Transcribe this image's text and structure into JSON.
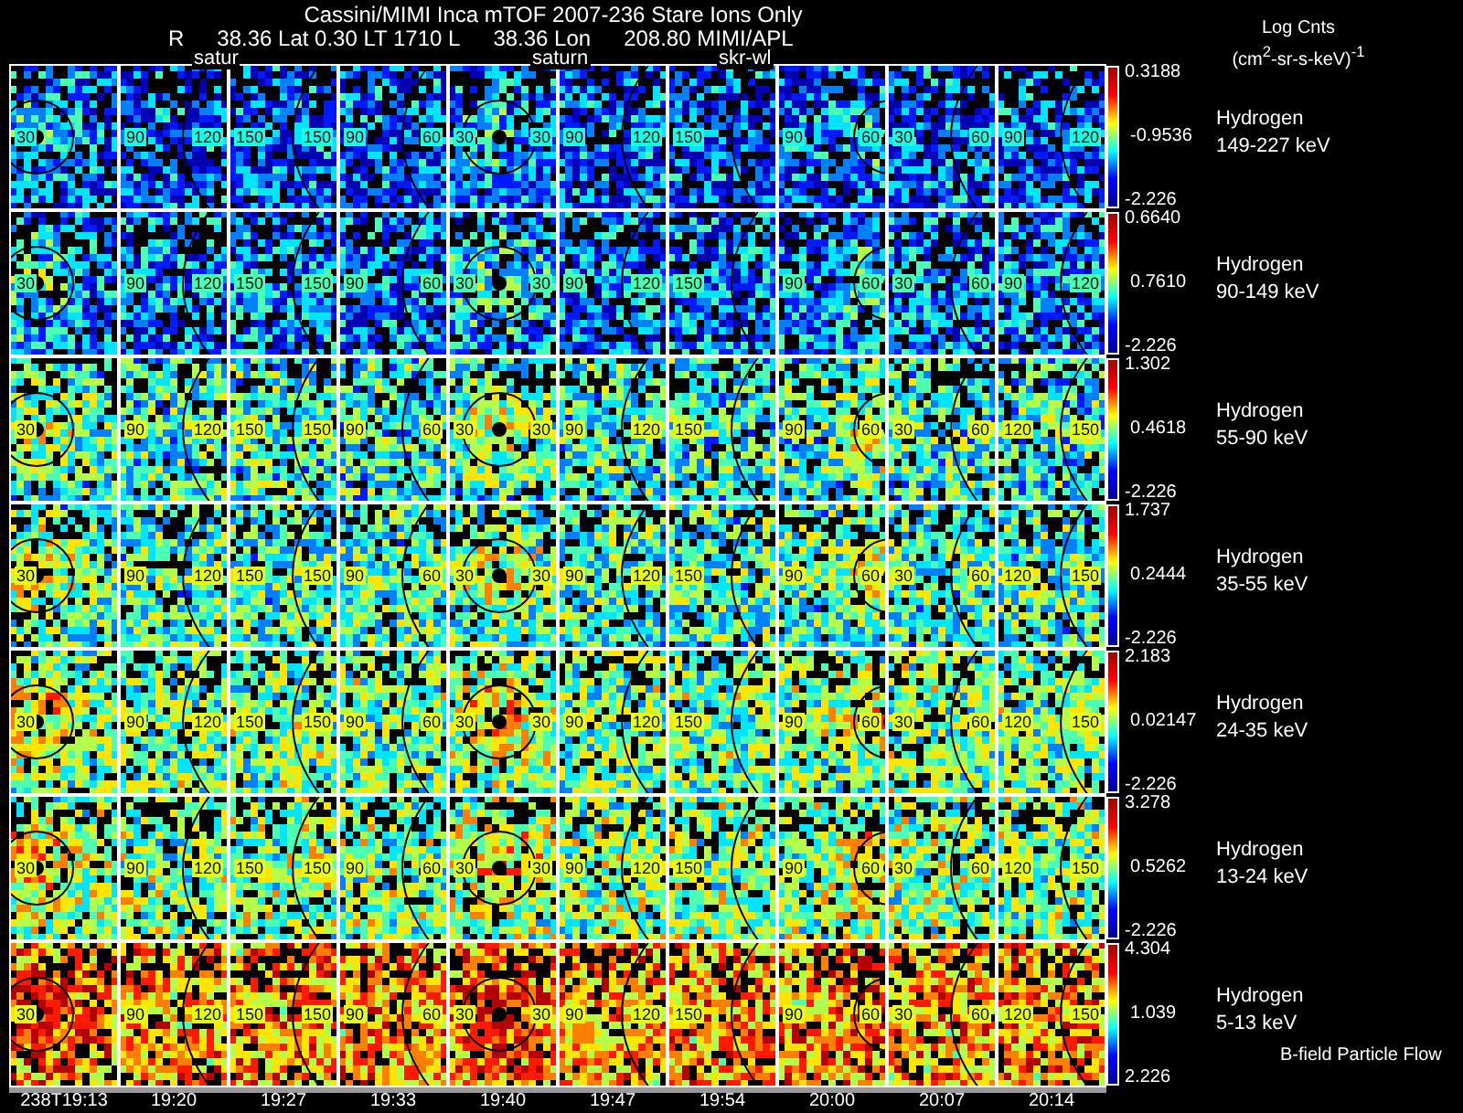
{
  "title": "Cassini/MIMI Inca mTOF  2007-236   Stare   Ions Only",
  "subtitle": [
    "R",
    "38.36 Lat 0.30 LT 1710 L",
    "38.36 Lon",
    "208.80  MIMI/APL"
  ],
  "overlay_labels": [
    "satur",
    "saturn",
    "skr-wl"
  ],
  "colorbar_title": "Log Cnts",
  "colorbar_units": "(cm$^{2}$-sr-s-keV)$^{-1}$",
  "rows": [
    {
      "species": "Hydrogen",
      "energy": "149-227 keV",
      "max": "0.3188",
      "mid": "-0.9536",
      "min": "-2.226",
      "panels": [
        {
          "labels": [
            "30"
          ]
        },
        {
          "labels": [
            "90",
            "120"
          ]
        },
        {
          "labels": [
            "150",
            "150"
          ]
        },
        {
          "labels": [
            "90",
            "60"
          ]
        },
        {
          "labels": [
            "30",
            "30"
          ]
        },
        {
          "labels": [
            "90",
            "120"
          ]
        },
        {
          "labels": [
            "150"
          ]
        },
        {
          "labels": [
            "90",
            "60"
          ]
        },
        {
          "labels": [
            "30",
            "60"
          ]
        },
        {
          "labels": [
            "90",
            "120"
          ]
        }
      ]
    },
    {
      "species": "Hydrogen",
      "energy": "90-149 keV",
      "max": "0.6640",
      "mid": "0.7610",
      "min": "-2.226",
      "panels": [
        {
          "labels": [
            "30"
          ]
        },
        {
          "labels": [
            "90",
            "120"
          ]
        },
        {
          "labels": [
            "150",
            "150"
          ]
        },
        {
          "labels": [
            "90",
            "60"
          ]
        },
        {
          "labels": [
            "30",
            "30"
          ]
        },
        {
          "labels": [
            "90",
            "120"
          ]
        },
        {
          "labels": [
            "150"
          ]
        },
        {
          "labels": [
            "90",
            "60"
          ]
        },
        {
          "labels": [
            "30",
            "60"
          ]
        },
        {
          "labels": [
            "90",
            "120"
          ]
        }
      ]
    },
    {
      "species": "Hydrogen",
      "energy": "55-90 keV",
      "max": "1.302",
      "mid": "0.4618",
      "min": "-2.226",
      "panels": [
        {
          "labels": [
            "30"
          ]
        },
        {
          "labels": [
            "90",
            "120"
          ]
        },
        {
          "labels": [
            "150",
            "150"
          ]
        },
        {
          "labels": [
            "90",
            "60"
          ]
        },
        {
          "labels": [
            "30",
            "30"
          ]
        },
        {
          "labels": [
            "90",
            "120"
          ]
        },
        {
          "labels": [
            "150"
          ]
        },
        {
          "labels": [
            "90",
            "60"
          ]
        },
        {
          "labels": [
            "30",
            "60"
          ]
        },
        {
          "labels": [
            "120",
            "150"
          ]
        }
      ]
    },
    {
      "species": "Hydrogen",
      "energy": "35-55 keV",
      "max": "1.737",
      "mid": "0.2444",
      "min": "-2.226",
      "panels": [
        {
          "labels": [
            "30"
          ]
        },
        {
          "labels": [
            "90",
            "120"
          ]
        },
        {
          "labels": [
            "150",
            "150"
          ]
        },
        {
          "labels": [
            "90",
            "60"
          ]
        },
        {
          "labels": [
            "30",
            "30"
          ]
        },
        {
          "labels": [
            "90",
            "120"
          ]
        },
        {
          "labels": [
            "150"
          ]
        },
        {
          "labels": [
            "90",
            "60"
          ]
        },
        {
          "labels": [
            "30",
            "60"
          ]
        },
        {
          "labels": [
            "120",
            "150"
          ]
        }
      ]
    },
    {
      "species": "Hydrogen",
      "energy": "24-35 keV",
      "max": "2.183",
      "mid": "0.02147",
      "min": "-2.226",
      "panels": [
        {
          "labels": [
            "30"
          ]
        },
        {
          "labels": [
            "90",
            "120"
          ]
        },
        {
          "labels": [
            "150",
            "150"
          ]
        },
        {
          "labels": [
            "90",
            "60"
          ]
        },
        {
          "labels": [
            "30",
            "30"
          ]
        },
        {
          "labels": [
            "90",
            "120"
          ]
        },
        {
          "labels": [
            "150"
          ]
        },
        {
          "labels": [
            "90",
            "60"
          ]
        },
        {
          "labels": [
            "30",
            "60"
          ]
        },
        {
          "labels": [
            "120",
            "150"
          ]
        }
      ]
    },
    {
      "species": "Hydrogen",
      "energy": "13-24 keV",
      "max": "3.278",
      "mid": "0.5262",
      "min": "-2.226",
      "panels": [
        {
          "labels": [
            "30"
          ]
        },
        {
          "labels": [
            "90",
            "120"
          ]
        },
        {
          "labels": [
            "150",
            "150"
          ]
        },
        {
          "labels": [
            "90",
            "60"
          ]
        },
        {
          "labels": [
            "30",
            "30"
          ]
        },
        {
          "labels": [
            "90",
            "120"
          ]
        },
        {
          "labels": [
            "150"
          ]
        },
        {
          "labels": [
            "90",
            "60"
          ]
        },
        {
          "labels": [
            "30",
            "60"
          ]
        },
        {
          "labels": [
            "120",
            "150"
          ]
        }
      ]
    },
    {
      "species": "Hydrogen",
      "energy": "5-13 keV",
      "max": "4.304",
      "mid": "1.039",
      "min": "2.226",
      "panels": [
        {
          "labels": [
            "30"
          ]
        },
        {
          "labels": [
            "90",
            "120"
          ]
        },
        {
          "labels": [
            "150",
            "150"
          ]
        },
        {
          "labels": [
            "90",
            "60"
          ]
        },
        {
          "labels": [
            "30",
            "30"
          ]
        },
        {
          "labels": [
            "90",
            "120"
          ]
        },
        {
          "labels": [
            "150"
          ]
        },
        {
          "labels": [
            "90",
            "60"
          ]
        },
        {
          "labels": [
            "30",
            "60"
          ]
        },
        {
          "labels": [
            "120",
            "150"
          ]
        }
      ]
    }
  ],
  "legend_note": "B-field Particle Flow",
  "times": [
    "238T19:13",
    "19:20",
    "19:27",
    "19:33",
    "19:40",
    "19:47",
    "19:54",
    "20:00",
    "20:07",
    "20:14"
  ]
}
